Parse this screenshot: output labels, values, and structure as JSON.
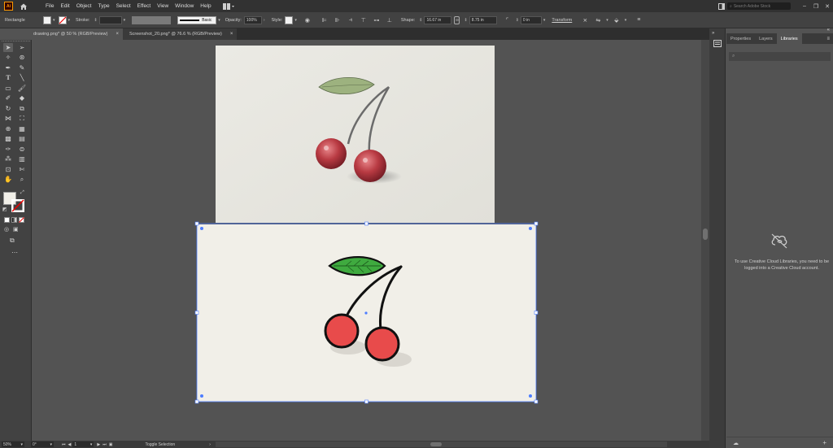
{
  "menubar": {
    "logo": "Ai",
    "items": [
      "File",
      "Edit",
      "Object",
      "Type",
      "Select",
      "Effect",
      "View",
      "Window",
      "Help"
    ],
    "search_placeholder": "Search Adobe Stock"
  },
  "controlbar": {
    "selection_type": "Rectangle",
    "stroke_label": "Stroke:",
    "stroke_style": "Basic",
    "opacity_label": "Opacity:",
    "opacity_value": "100%",
    "style_label": "Style:",
    "shape_label": "Shape:",
    "width_value": "16.67 in",
    "height_value": "8.75 in",
    "corner_value": "0 in",
    "transform_label": "Transform"
  },
  "tabs": [
    {
      "label": "drawing.png* @ 50 % (RGB/Preview)",
      "close": "×"
    },
    {
      "label": "Screenshot_20.png* @ 76.6 % (RGB/Preview)",
      "close": "×"
    }
  ],
  "statusbar": {
    "zoom": "50%",
    "rotation": "0°",
    "artboard": "1",
    "status": "Toggle Selection"
  },
  "panel": {
    "tabs": [
      "Properties",
      "Layers",
      "Libraries"
    ],
    "active_tab": "Libraries",
    "message": "To use Creative Cloud Libraries, you need to be logged into a Creative Cloud account."
  },
  "colors": {
    "ui_dark": "#323232",
    "ui_mid": "#424242",
    "canvas_bg": "#535353",
    "artboard_bg": "#f1efe8",
    "selection_blue": "#4d7dff",
    "cherry_red": "#e84b4b",
    "leaf_green": "#3faa3f",
    "logo_orange": "#ff9a00"
  }
}
